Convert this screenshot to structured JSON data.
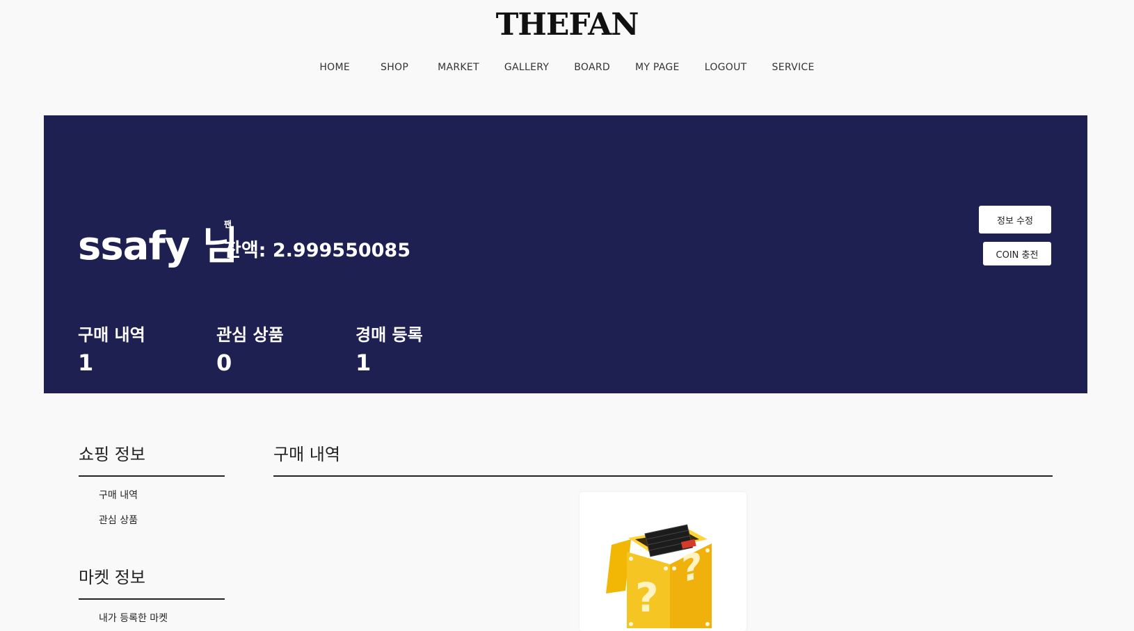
{
  "header": {
    "logo": "THEFAN",
    "nav": [
      "HOME",
      "SHOP",
      "MARKET",
      "GALLERY",
      "BOARD",
      "MY PAGE",
      "LOGOUT",
      "SERVICE"
    ]
  },
  "profile": {
    "username": "ssafy 님",
    "currency_label": "팬",
    "balance": "잔액: 2.999550085",
    "edit_button": "정보 수정",
    "coin_button": "COIN 충전",
    "stats": [
      {
        "label": "구매 내역",
        "value": "1"
      },
      {
        "label": "관심 상품",
        "value": "0"
      },
      {
        "label": "경매 등록",
        "value": "1"
      }
    ]
  },
  "sidebar": {
    "shopping": {
      "title": "쇼핑 정보",
      "links": [
        "구매 내역",
        "관심 상품"
      ]
    },
    "market": {
      "title": "마켓 정보",
      "links": [
        "내가 등록한 마켓"
      ]
    }
  },
  "main": {
    "title": "구매 내역",
    "product_image": "mystery-box-image"
  },
  "colors": {
    "banner": "#1e2052",
    "page_bg": "#f9f9f9",
    "box_yellow": "#f5c623"
  }
}
